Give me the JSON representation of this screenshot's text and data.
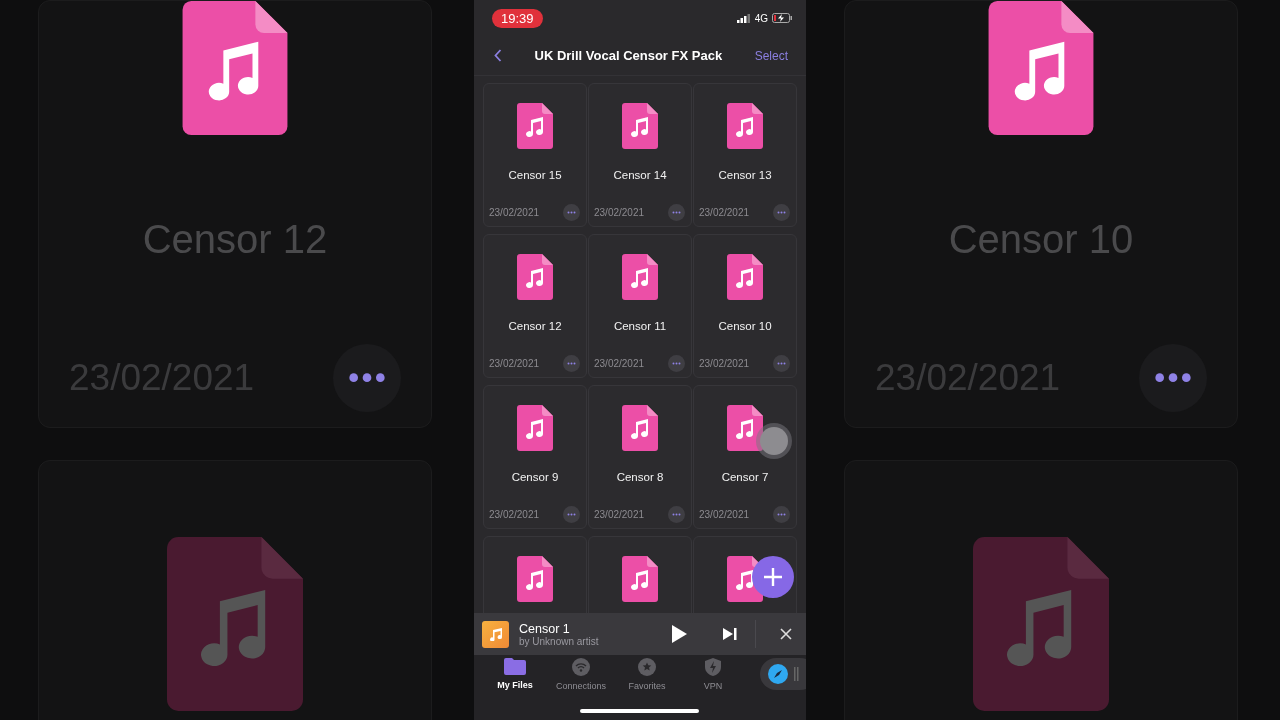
{
  "backdrop": {
    "left": {
      "name": "Censor 12",
      "date": "23/02/2021"
    },
    "right": {
      "name": "Censor 10",
      "date": "23/02/2021"
    }
  },
  "status_bar": {
    "time": "19:39",
    "network": "4G"
  },
  "nav": {
    "title": "UK Drill Vocal Censor FX Pack",
    "action": "Select"
  },
  "files": [
    {
      "kind": "file",
      "name": "Censor 15",
      "date": "23/02/2021"
    },
    {
      "kind": "file",
      "name": "Censor 14",
      "date": "23/02/2021"
    },
    {
      "kind": "file",
      "name": "Censor 13",
      "date": "23/02/2021"
    },
    {
      "kind": "file",
      "name": "Censor 12",
      "date": "23/02/2021"
    },
    {
      "kind": "file",
      "name": "Censor 11",
      "date": "23/02/2021"
    },
    {
      "kind": "file",
      "name": "Censor 10",
      "date": "23/02/2021"
    },
    {
      "kind": "file",
      "name": "Censor 9",
      "date": "23/02/2021"
    },
    {
      "kind": "file",
      "name": "Censor 8",
      "date": "23/02/2021"
    },
    {
      "kind": "file",
      "name": "Censor 7",
      "date": "23/02/2021"
    },
    {
      "kind": "partial"
    },
    {
      "kind": "partial"
    },
    {
      "kind": "partial"
    }
  ],
  "player": {
    "title": "Censor 1",
    "artist": "by Unknown artist"
  },
  "tabs": [
    {
      "label": "My Files",
      "selected": true
    },
    {
      "label": "Connections",
      "selected": false
    },
    {
      "label": "Favorites",
      "selected": false
    },
    {
      "label": "VPN",
      "selected": false
    }
  ]
}
